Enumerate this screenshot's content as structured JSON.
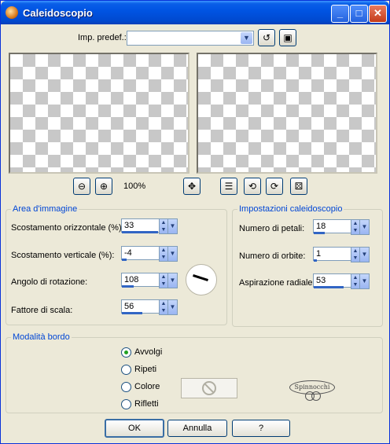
{
  "window": {
    "title": "Caleidoscopio",
    "minimize": "_",
    "maximize": "□",
    "close": "✕"
  },
  "presets": {
    "label": "Imp. predef.:",
    "value": ""
  },
  "zoom": {
    "level": "100%"
  },
  "image_area": {
    "title": "Area d'immagine",
    "horizontal_offset": {
      "label": "Scostamento orizzontale (%):",
      "value": "33"
    },
    "vertical_offset": {
      "label": "Scostamento verticale (%):",
      "value": "-4"
    },
    "rotation_angle": {
      "label": "Angolo di rotazione:",
      "value": "108"
    },
    "scale_factor": {
      "label": "Fattore di scala:",
      "value": "56"
    }
  },
  "kaleidoscope": {
    "title": "Impostazioni caleidoscopio",
    "petals": {
      "label": "Numero di petali:",
      "value": "18"
    },
    "orbits": {
      "label": "Numero di orbite:",
      "value": "1"
    },
    "radial_suction": {
      "label": "Aspirazione radiale:",
      "value": "53"
    }
  },
  "edge_mode": {
    "title": "Modalità bordo",
    "options": [
      "Avvolgi",
      "Ripeti",
      "Colore",
      "Rifletti"
    ],
    "selected": "Avvolgi"
  },
  "buttons": {
    "ok": "OK",
    "cancel": "Annulla",
    "help": "?"
  },
  "signature": "Spinnocchi",
  "colors": {
    "accent": "#0046d5",
    "titlebar": "#0054e3",
    "progress": "#3165c4"
  }
}
